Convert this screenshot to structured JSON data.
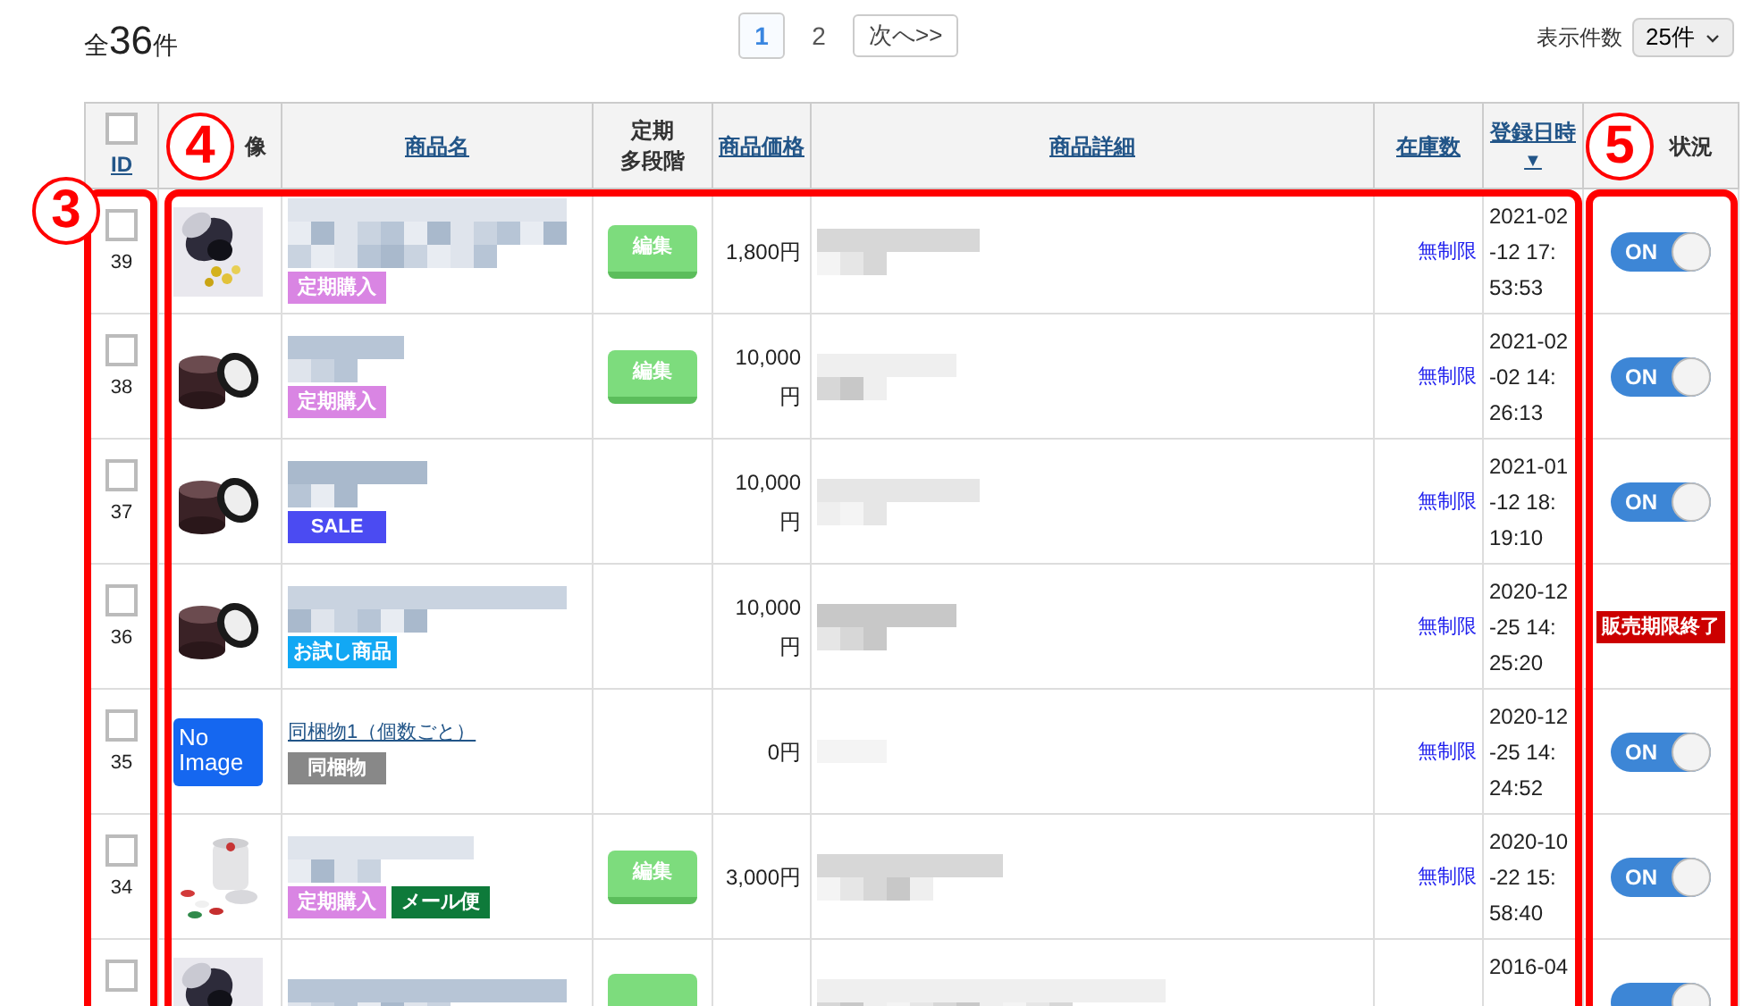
{
  "summary": {
    "prefix": "全",
    "count": "36",
    "suffix": "件"
  },
  "pagination": {
    "pages": [
      {
        "label": "1",
        "selected": true
      },
      {
        "label": "2",
        "selected": false
      }
    ],
    "next": "次へ>>"
  },
  "per_page": {
    "label": "表示件数",
    "value": "25件"
  },
  "columns": [
    {
      "kind": "id",
      "label": "ID",
      "checked": false
    },
    {
      "kind": "plain",
      "lines": [
        "像"
      ]
    },
    {
      "kind": "link",
      "label": "商品名"
    },
    {
      "kind": "plain",
      "lines": [
        "定期",
        "多段階"
      ]
    },
    {
      "kind": "link",
      "label": "商品価格"
    },
    {
      "kind": "link",
      "label": "商品詳細"
    },
    {
      "kind": "link",
      "label": "在庫数"
    },
    {
      "kind": "sort",
      "label": "登録日時",
      "arrow": "▼"
    },
    {
      "kind": "plain",
      "lines": [
        "状況"
      ]
    }
  ],
  "rows": [
    {
      "checked": false,
      "id": "39",
      "image": {
        "kind": "picture"
      },
      "name": {
        "kind": "blurred"
      },
      "tags": [
        {
          "text": "定期購入",
          "color": "#d985e3"
        }
      ],
      "edit": {
        "label": "編集"
      },
      "price": "1,800円",
      "stock": "無制限",
      "registered": [
        "2021-02",
        "-12 17:",
        "53:53"
      ],
      "status": {
        "kind": "toggle",
        "on": true,
        "text": "ON"
      }
    },
    {
      "checked": false,
      "id": "38",
      "image": {
        "kind": "picture"
      },
      "name": {
        "kind": "blurred"
      },
      "tags": [
        {
          "text": "定期購入",
          "color": "#d985e3"
        }
      ],
      "edit": {
        "label": "編集"
      },
      "price": "10,000円",
      "stock": "無制限",
      "registered": [
        "2021-02",
        "-02 14:",
        "26:13"
      ],
      "status": {
        "kind": "toggle",
        "on": true,
        "text": "ON"
      }
    },
    {
      "checked": false,
      "id": "37",
      "image": {
        "kind": "picture"
      },
      "name": {
        "kind": "blurred"
      },
      "tags": [
        {
          "text": "SALE",
          "color": "#4b4bf2"
        }
      ],
      "price": "10,000円",
      "stock": "無制限",
      "registered": [
        "2021-01",
        "-12 18:",
        "19:10"
      ],
      "status": {
        "kind": "toggle",
        "on": true,
        "text": "ON"
      }
    },
    {
      "checked": false,
      "id": "36",
      "image": {
        "kind": "picture"
      },
      "name": {
        "kind": "blurred"
      },
      "tags": [
        {
          "text": "お試し商品",
          "color": "#12a8f4"
        }
      ],
      "price": "10,000円",
      "stock": "無制限",
      "registered": [
        "2020-12",
        "-25 14:",
        "25:20"
      ],
      "status": {
        "kind": "label",
        "text": "販売期限終了"
      }
    },
    {
      "checked": false,
      "id": "35",
      "image": {
        "kind": "noimage",
        "text": "No Image"
      },
      "name": {
        "kind": "link",
        "text": "同梱物1（個数ごと）"
      },
      "tags": [
        {
          "text": "同梱物",
          "color": "#888888"
        }
      ],
      "price": "0円",
      "stock": "無制限",
      "registered": [
        "2020-12",
        "-25 14:",
        "24:52"
      ],
      "status": {
        "kind": "toggle",
        "on": true,
        "text": "ON"
      }
    },
    {
      "checked": false,
      "id": "34",
      "image": {
        "kind": "picture"
      },
      "name": {
        "kind": "blurred"
      },
      "tags": [
        {
          "text": "定期購入",
          "color": "#d985e3"
        },
        {
          "text": "メール便",
          "color": "#0e7a3a"
        }
      ],
      "edit": {
        "label": "編集"
      },
      "price": "3,000円",
      "stock": "無制限",
      "registered": [
        "2020-10",
        "-22 15:",
        "58:40"
      ],
      "status": {
        "kind": "toggle",
        "on": true,
        "text": "ON"
      }
    },
    {
      "checked": false,
      "image": {
        "kind": "picture"
      },
      "name": {
        "kind": "blurred"
      },
      "edit": {
        "visible": true
      },
      "registered": [
        "2016-04"
      ],
      "status": {
        "kind": "toggle",
        "on": true
      }
    }
  ],
  "annotations": [
    {
      "label": "3"
    },
    {
      "label": "4"
    },
    {
      "label": "5"
    }
  ]
}
